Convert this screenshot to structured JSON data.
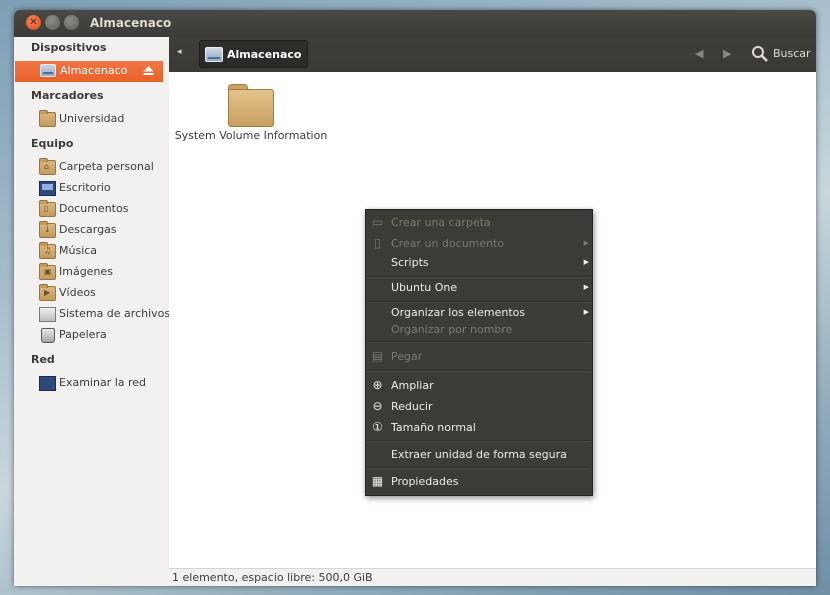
{
  "window": {
    "title": "Almacenaco"
  },
  "toolbar": {
    "path_button": "Almacenaco",
    "search_label": "Buscar"
  },
  "sidebar": {
    "sections": {
      "devices": "Dispositivos",
      "bookmarks": "Marcadores",
      "computer": "Equipo",
      "network": "Red"
    },
    "devices": [
      {
        "label": "Almacenaco",
        "selected": true
      }
    ],
    "bookmarks": [
      {
        "label": "Universidad"
      }
    ],
    "computer": [
      {
        "label": "Carpeta personal",
        "icon": "home-folder-icon"
      },
      {
        "label": "Escritorio",
        "icon": "desktop-icon"
      },
      {
        "label": "Documentos",
        "icon": "documents-folder-icon"
      },
      {
        "label": "Descargas",
        "icon": "downloads-folder-icon"
      },
      {
        "label": "Música",
        "icon": "music-folder-icon"
      },
      {
        "label": "Imágenes",
        "icon": "pictures-folder-icon"
      },
      {
        "label": "Vídeos",
        "icon": "videos-folder-icon"
      },
      {
        "label": "Sistema de archivos",
        "icon": "filesystem-icon"
      },
      {
        "label": "Papelera",
        "icon": "trash-icon"
      }
    ],
    "network": [
      {
        "label": "Examinar la red"
      }
    ]
  },
  "main": {
    "items": [
      {
        "label": "System Volume Information",
        "icon": "folder-icon"
      }
    ]
  },
  "statusbar": {
    "text": "1 elemento, espacio libre: 500,0 GiB"
  },
  "context_menu": {
    "items": [
      {
        "label": "Crear una carpeta",
        "enabled": false
      },
      {
        "label": "Crear un documento",
        "enabled": false,
        "submenu": true
      },
      {
        "label": "Scripts",
        "enabled": true,
        "submenu": true
      },
      {
        "label": "Ubuntu One",
        "enabled": true,
        "submenu": true
      },
      {
        "label": "Organizar los elementos",
        "enabled": true,
        "submenu": true
      },
      {
        "label": "Organizar por nombre",
        "enabled": false
      },
      {
        "label": "Pegar",
        "enabled": false
      },
      {
        "label": "Ampliar",
        "enabled": true
      },
      {
        "label": "Reducir",
        "enabled": true
      },
      {
        "label": "Tamaño normal",
        "enabled": true
      },
      {
        "label": "Extraer unidad de forma segura",
        "enabled": true
      },
      {
        "label": "Propiedades",
        "enabled": true
      }
    ]
  },
  "colors": {
    "accent": "#e95f28",
    "titlebar": "#3c3b37",
    "menu_bg": "#3c3b37"
  }
}
